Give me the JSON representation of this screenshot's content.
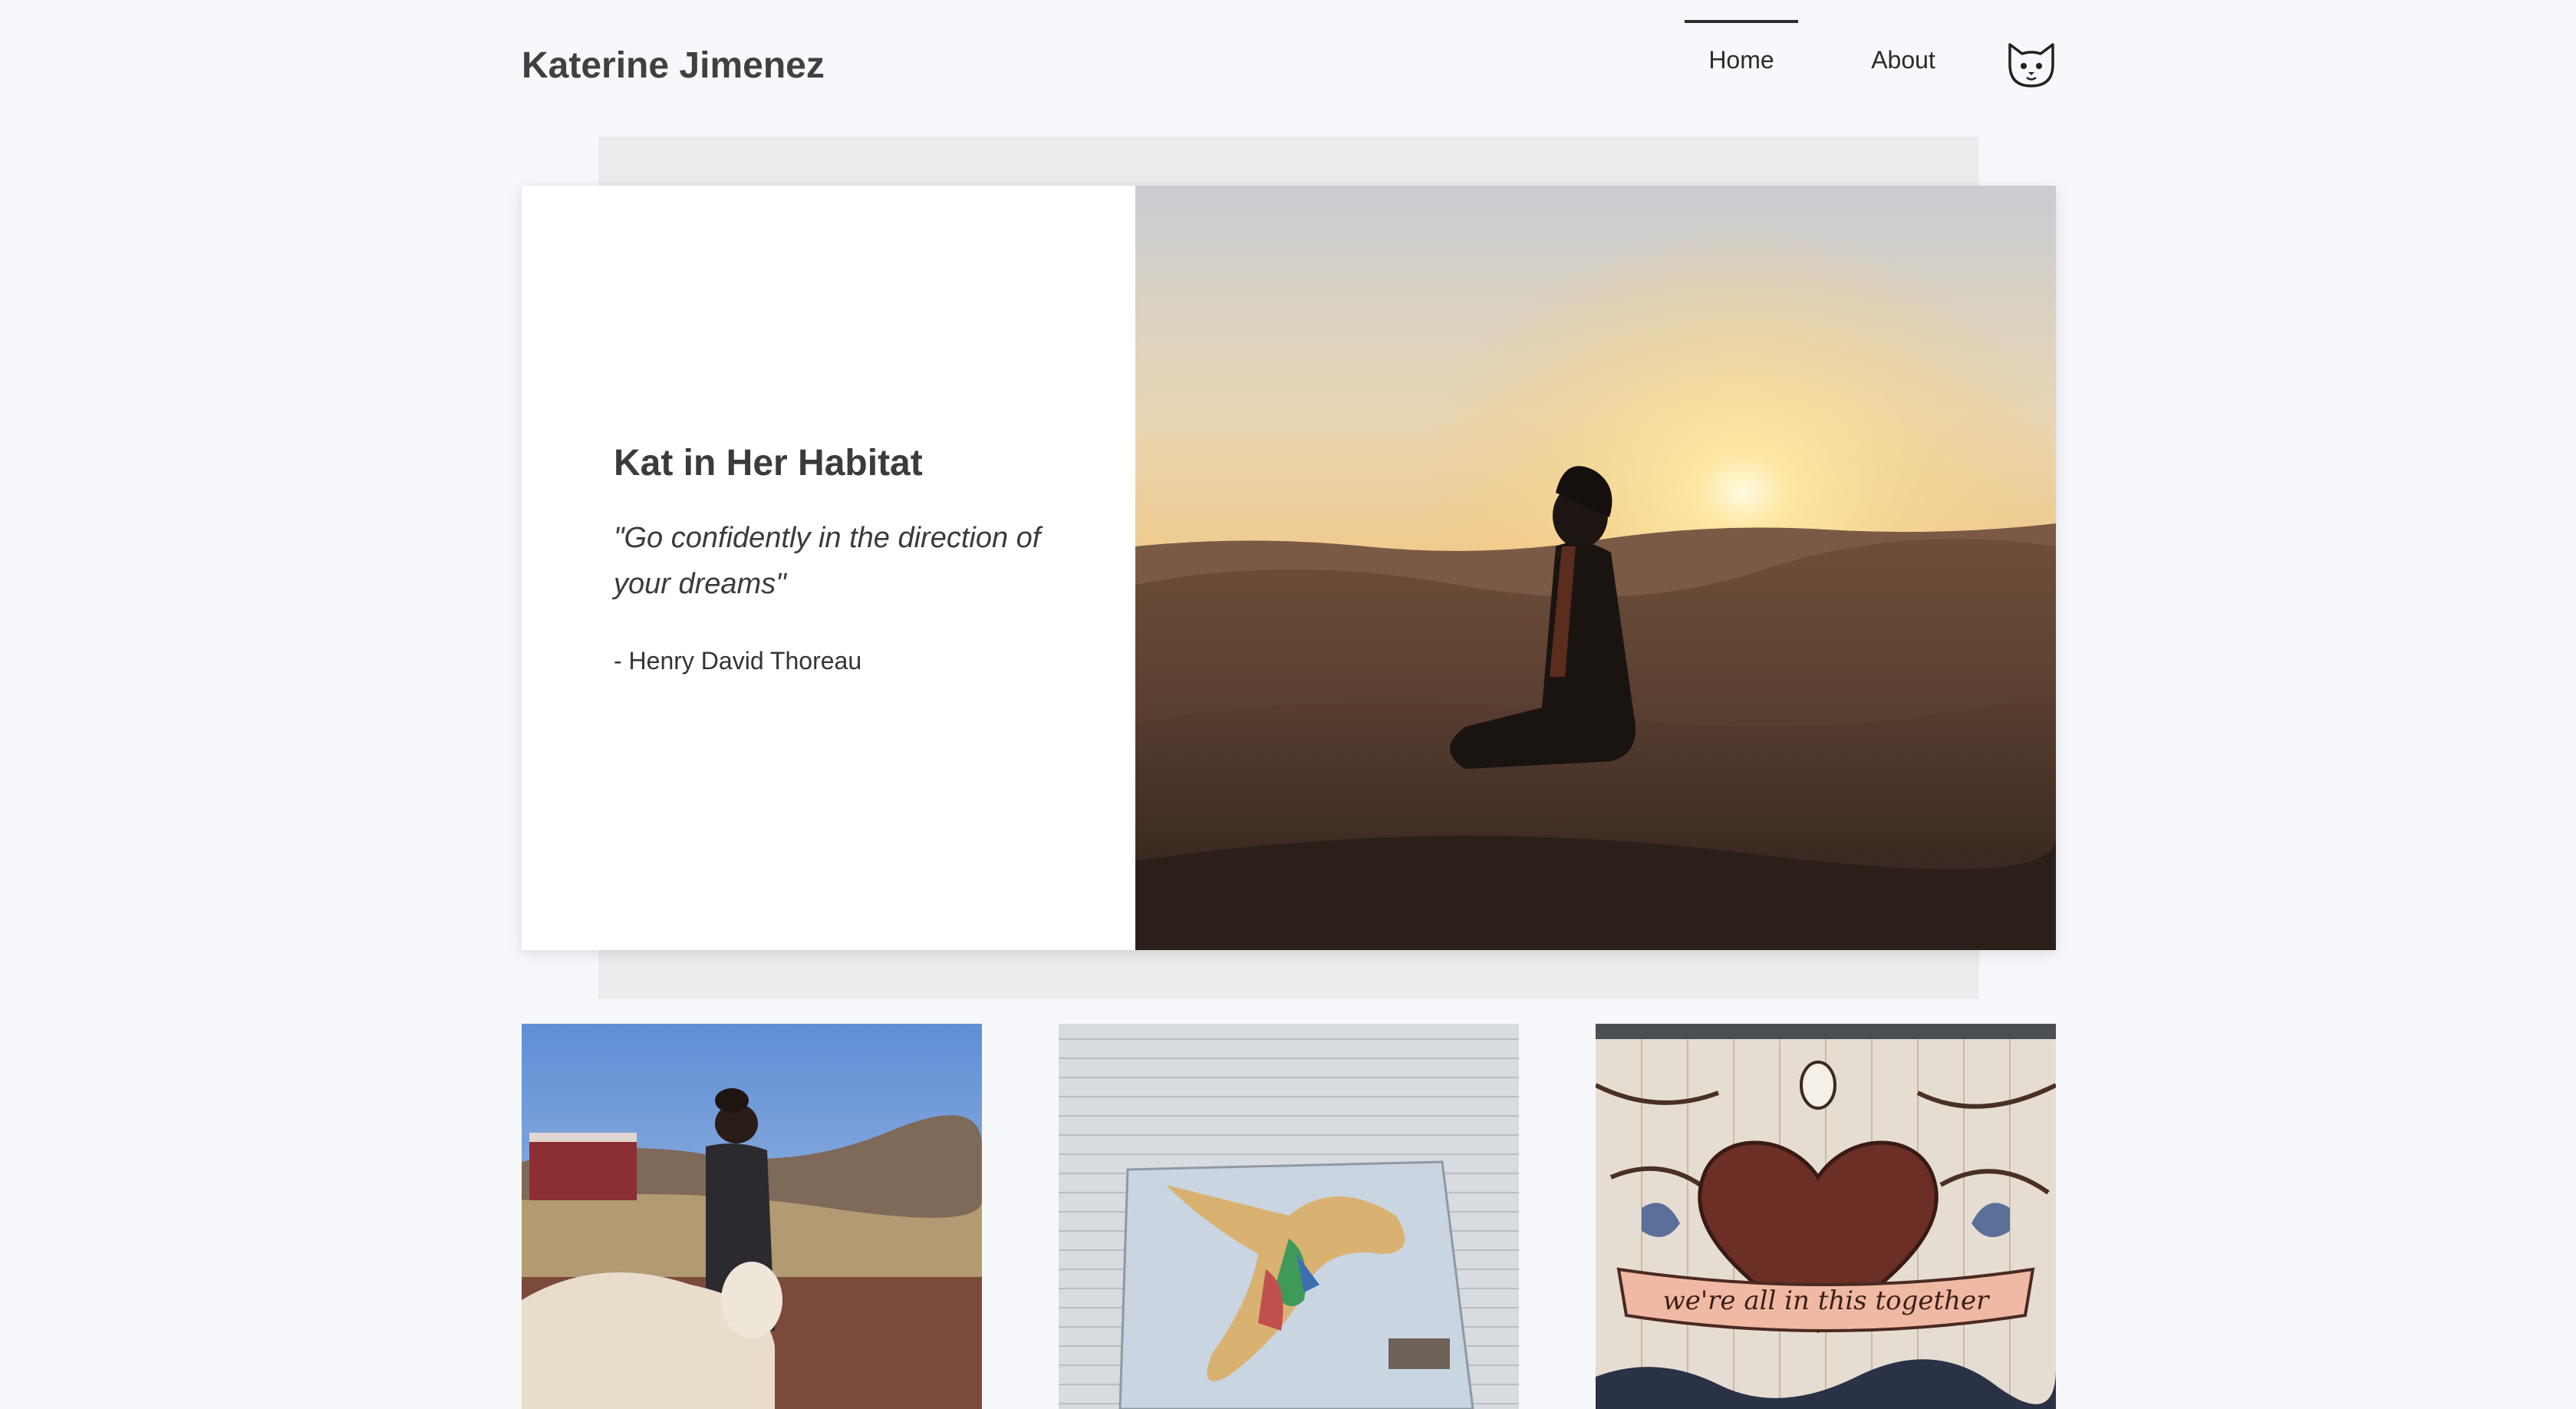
{
  "header": {
    "site_title": "Katerine Jimenez",
    "nav": [
      {
        "label": "Home",
        "active": true
      },
      {
        "label": "About",
        "active": false
      }
    ],
    "icon": "cat-face-icon"
  },
  "hero": {
    "heading": "Kat in Her Habitat",
    "quote": "\"Go confidently in the direction of your dreams\"",
    "author": "- Henry David Thoreau",
    "photo": "desert-sunset-photo"
  },
  "gallery": [
    {
      "photo": "alpaca-mountain-photo"
    },
    {
      "photo": "dancer-mural-photo"
    },
    {
      "photo": "heart-mural-photo",
      "mural_text": "we're all in this together"
    }
  ],
  "colors": {
    "background": "#f6f8fc",
    "band": "#ececec",
    "card": "#ffffff",
    "text": "#3d3d3d"
  }
}
